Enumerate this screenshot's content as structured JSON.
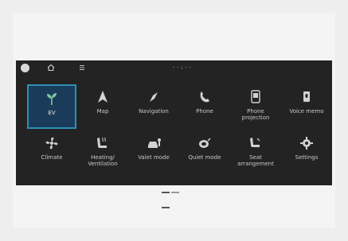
{
  "status_bar": {
    "time": "--:--"
  },
  "menu": {
    "rows": [
      [
        {
          "label": "EV",
          "icon": "leaf-icon",
          "selected": true
        },
        {
          "label": "Map",
          "icon": "map-arrow-icon"
        },
        {
          "label": "Navigation",
          "icon": "compass-icon"
        },
        {
          "label": "Phone",
          "icon": "phone-icon"
        },
        {
          "label": "Phone\nprojection",
          "icon": "phone-projection-icon"
        },
        {
          "label": "Voice memo",
          "icon": "voice-memo-icon"
        }
      ],
      [
        {
          "label": "Climate",
          "icon": "fan-icon"
        },
        {
          "label": "Heating/\nVentilation",
          "icon": "seat-heat-icon"
        },
        {
          "label": "Valet mode",
          "icon": "valet-car-icon"
        },
        {
          "label": "Quiet mode",
          "icon": "quiet-mode-icon"
        },
        {
          "label": "Seat\narrangement",
          "icon": "seat-icon"
        },
        {
          "label": "Settings",
          "icon": "gear-icon"
        }
      ]
    ]
  },
  "colors": {
    "background": "#232323",
    "selected_border": "#2f8fb6",
    "selected_fill": "#1a3c5a"
  }
}
